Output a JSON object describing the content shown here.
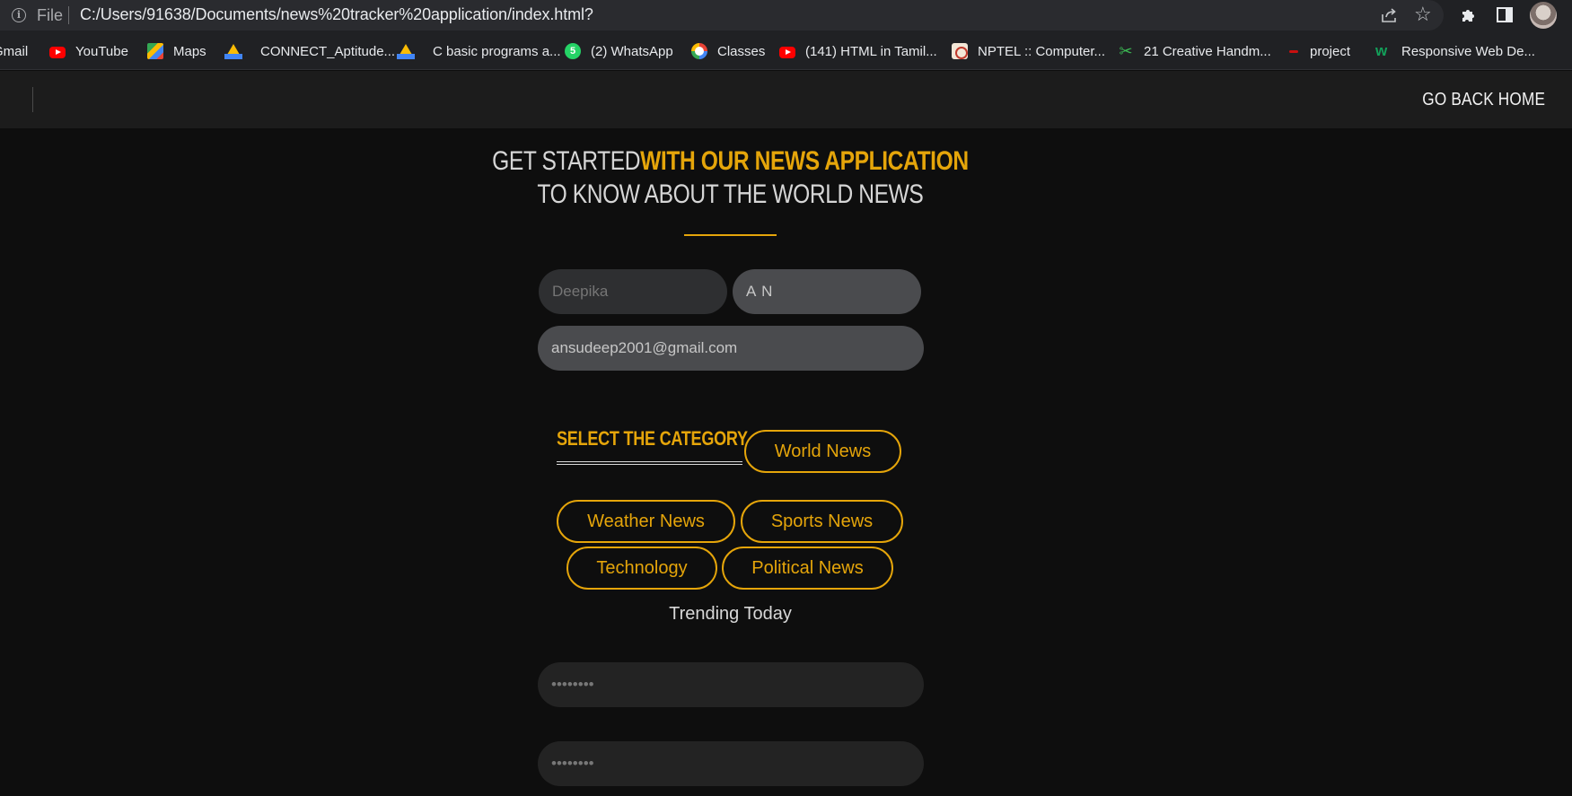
{
  "browser": {
    "file_label": "File",
    "url": "C:/Users/91638/Documents/news%20tracker%20application/index.html?",
    "bookmarks": [
      {
        "label": "Gmail",
        "icon": "gmail-icon"
      },
      {
        "label": "YouTube",
        "icon": "youtube-icon"
      },
      {
        "label": "Maps",
        "icon": "maps-icon"
      },
      {
        "label": "CONNECT_Aptitude...",
        "icon": "google-drive-icon"
      },
      {
        "label": "C basic programs a...",
        "icon": "google-drive-icon"
      },
      {
        "label": "(2) WhatsApp",
        "icon": "whatsapp-icon"
      },
      {
        "label": "Classes",
        "icon": "google-icon"
      },
      {
        "label": "(141) HTML in Tamil...",
        "icon": "youtube-icon"
      },
      {
        "label": "NPTEL :: Computer...",
        "icon": "nptel-icon"
      },
      {
        "label": "21 Creative Handm...",
        "icon": "scissors-icon"
      },
      {
        "label": "project",
        "icon": "project-icon"
      },
      {
        "label": "Responsive Web De...",
        "icon": "w3schools-icon"
      }
    ]
  },
  "nav": {
    "home_link": "GO BACK HOME"
  },
  "hero": {
    "line1_light": "GET STARTED",
    "line1_accent": "WITH OUR NEWS APPLICATION",
    "line2": "TO KNOW ABOUT THE WORLD NEWS"
  },
  "form": {
    "first_name_placeholder": "Deepika",
    "last_name_value": "A N",
    "email_value": "ansudeep2001@gmail.com",
    "password_value": "password",
    "confirm_password_value": "password"
  },
  "category": {
    "title": "SELECT THE CATEGORY",
    "options": [
      "World News",
      "Weather News",
      "Sports News",
      "Technology",
      "Political News"
    ],
    "trending": "Trending Today"
  },
  "colors": {
    "accent": "#e5a50a",
    "background": "#0e0e0e",
    "nav_background": "#1c1c1c"
  }
}
